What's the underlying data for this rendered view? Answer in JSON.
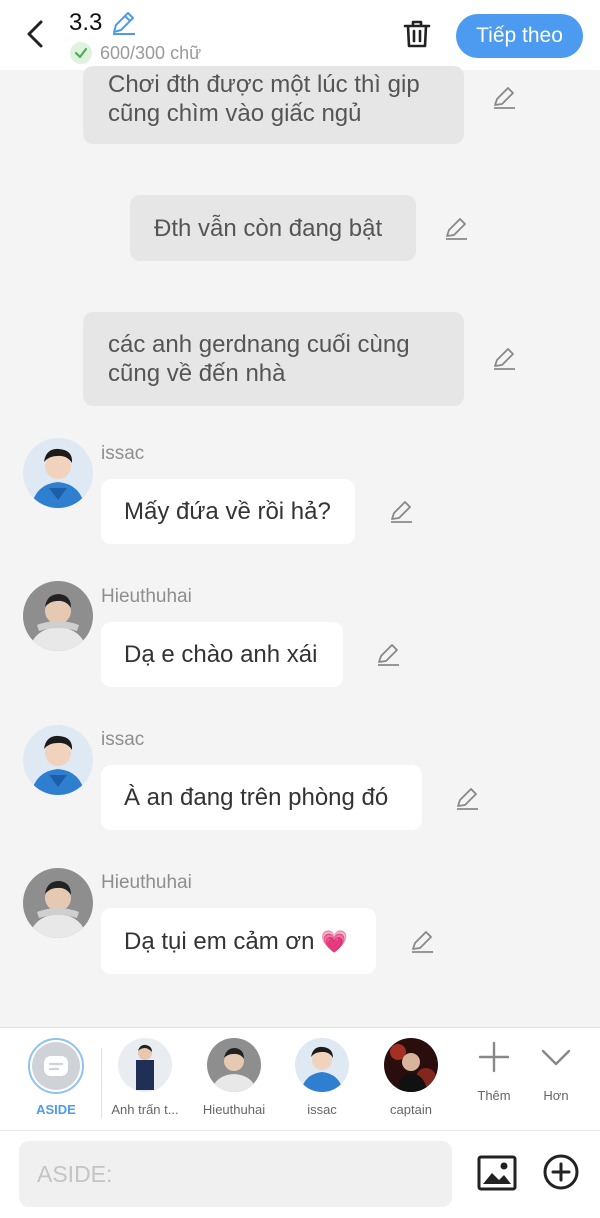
{
  "header": {
    "title": "3.3",
    "char_count": "600/300 chữ",
    "next_label": "Tiếp theo"
  },
  "messages": [
    {
      "type": "narration",
      "text": "Chơi đth được một lúc thì gip cũng chìm vào giấc ngủ"
    },
    {
      "type": "narration",
      "text": "Đth vẫn còn đang bật"
    },
    {
      "type": "narration",
      "text": "các anh gerdnang cuối cùng cũng về đến nhà"
    },
    {
      "type": "character",
      "sender": "issac",
      "text": "Mấy đứa về rồi hả?"
    },
    {
      "type": "character",
      "sender": "Hieuthuhai",
      "text": "Dạ e chào anh xái"
    },
    {
      "type": "character",
      "sender": "issac",
      "text": "À an đang trên phòng đó"
    },
    {
      "type": "character",
      "sender": "Hieuthuhai",
      "text": "Dạ tụi em cảm ơn",
      "emoji": "💗"
    }
  ],
  "character_bar": {
    "items": [
      {
        "label": "ASIDE",
        "selected": true
      },
      {
        "label": "Anh trấn t..."
      },
      {
        "label": "Hieuthuhai"
      },
      {
        "label": "issac"
      },
      {
        "label": "captain"
      }
    ],
    "more_label": "Thêm",
    "expand_label": "Hơn"
  },
  "composer": {
    "placeholder": "ASIDE:"
  },
  "colors": {
    "accent": "#4c9bf0",
    "narration_bubble": "#e6e6e6",
    "character_bubble": "#ffffff",
    "background": "#f4f4f4"
  }
}
